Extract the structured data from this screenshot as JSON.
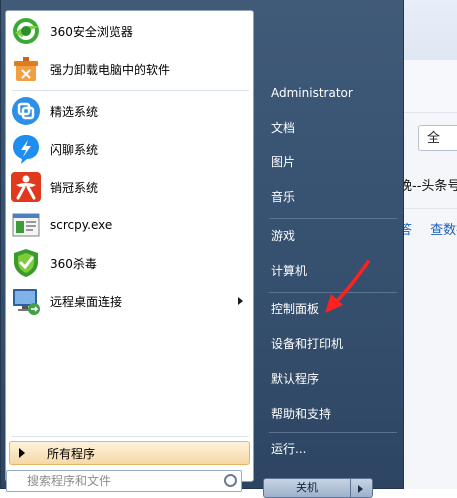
{
  "background_app": {
    "field_text": "全",
    "headline": "晚--头条号",
    "links": [
      "答",
      "查数据"
    ]
  },
  "start_menu": {
    "programs": [
      {
        "label": "360安全浏览器",
        "icon": "browser-360-icon"
      },
      {
        "label": "强力卸载电脑中的软件",
        "icon": "uninstall-icon"
      },
      {
        "label": "精选系统",
        "icon": "jingxuan-icon"
      },
      {
        "label": "闪聊系统",
        "icon": "lightning-chat-icon"
      },
      {
        "label": "销冠系统",
        "icon": "xiaoguan-icon"
      },
      {
        "label": "scrcpy.exe",
        "icon": "scrcpy-icon"
      },
      {
        "label": "360杀毒",
        "icon": "antivirus-360-icon"
      },
      {
        "label": "远程桌面连接",
        "icon": "remote-desktop-icon"
      }
    ],
    "all_programs": "所有程序",
    "search_placeholder": "搜索程序和文件",
    "right_items": {
      "user": "Administrator",
      "documents": "文档",
      "pictures": "图片",
      "music": "音乐",
      "games": "游戏",
      "computer": "计算机",
      "control_panel": "控制面板",
      "devices_printers": "设备和打印机",
      "default_programs": "默认程序",
      "help_support": "帮助和支持",
      "run": "运行..."
    },
    "shutdown": "关机"
  },
  "colors": {
    "annotation_arrow": "#ff2020",
    "all_programs_highlight": "#f6d8a6",
    "menu_dark": "#334d6b"
  }
}
